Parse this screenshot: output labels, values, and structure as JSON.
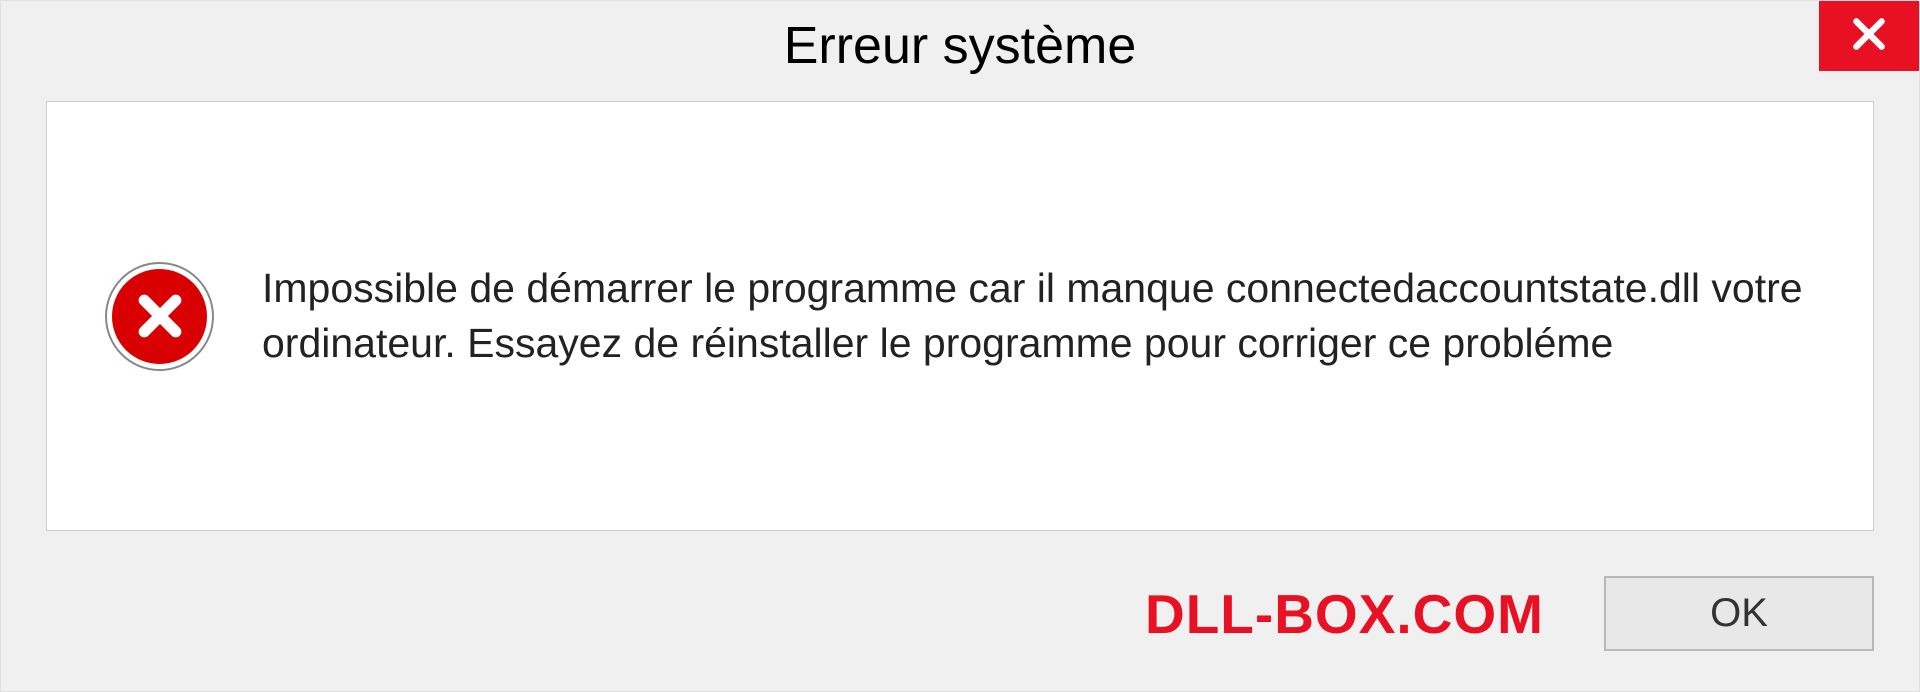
{
  "dialog": {
    "title": "Erreur système",
    "message": "Impossible de démarrer le programme car il manque connectedaccountstate.dll votre ordinateur. Essayez de réinstaller le programme pour corriger ce probléme",
    "ok_label": "OK"
  },
  "watermark": "DLL-BOX.COM",
  "colors": {
    "close_bg": "#e81123",
    "error_icon": "#d80000",
    "watermark": "#e81123"
  }
}
